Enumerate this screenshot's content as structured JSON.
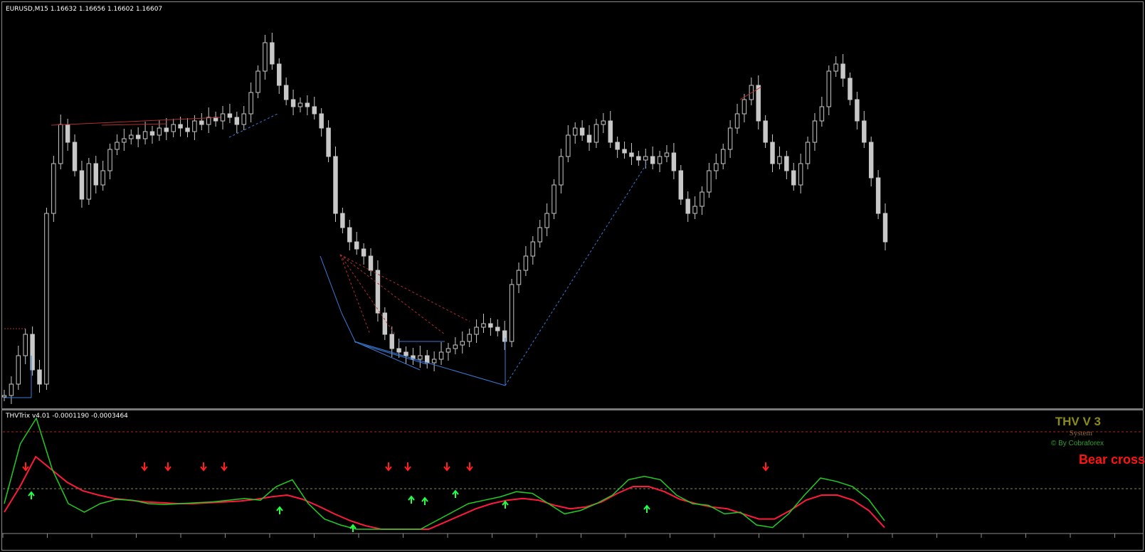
{
  "chart_header": {
    "symbol_line": "EURUSD,M15  1.16632 1.16656 1.16602 1.16607"
  },
  "indicator_header": {
    "label": "THVTrix v4.01 -0.0001190 -0.0003464"
  },
  "thv_box": {
    "title": "THV V 3",
    "system": "System",
    "by": "© By Cobraforex",
    "signal": "Bear cross",
    "signal_color": "#ff1414"
  },
  "colors": {
    "background": "#000000",
    "candles": "#c8c8c8",
    "trix_fast": "#22cc22",
    "trix_slow": "#ff1a3c",
    "arrow_up": "#22ff44",
    "arrow_down": "#ff2020",
    "trendline_blue": "#3a7bd5",
    "trendline_red": "#b03030",
    "level_line": "#b02020"
  },
  "chart_data": {
    "type": "line",
    "title": "",
    "price_path_relative": [
      560,
      540,
      500,
      470,
      520,
      540,
      300,
      230,
      175,
      200,
      240,
      280,
      230,
      260,
      240,
      210,
      200,
      195,
      190,
      195,
      185,
      190,
      180,
      185,
      175,
      180,
      185,
      170,
      175,
      165,
      170,
      160,
      165,
      175,
      160,
      130,
      100,
      60,
      90,
      120,
      140,
      150,
      145,
      150,
      160,
      180,
      220,
      300,
      320,
      340,
      350,
      360,
      380,
      440,
      470,
      490,
      495,
      500,
      505,
      500,
      510,
      505,
      495,
      490,
      485,
      480,
      470,
      460,
      455,
      460,
      465,
      480,
      400,
      380,
      360,
      340,
      320,
      300,
      260,
      220,
      190,
      180,
      190,
      200,
      175,
      170,
      200,
      210,
      215,
      220,
      225,
      220,
      230,
      220,
      215,
      240,
      280,
      300,
      290,
      270,
      240,
      230,
      210,
      180,
      160,
      140,
      120,
      170,
      200,
      230,
      220,
      240,
      260,
      230,
      200,
      170,
      150,
      100,
      90,
      110,
      140,
      170,
      200,
      250,
      300,
      340
    ],
    "trix_fast_relative": [
      100,
      30,
      0,
      60,
      100,
      110,
      100,
      95,
      96,
      100,
      101,
      100,
      99,
      98,
      96,
      94,
      96,
      80,
      72,
      100,
      118,
      125,
      130,
      135,
      140,
      150,
      143,
      120,
      110,
      100,
      96,
      92,
      86,
      88,
      100,
      112,
      108,
      100,
      90,
      72,
      68,
      72,
      90,
      100,
      102,
      112,
      110,
      125,
      128,
      112,
      90,
      70,
      74,
      80,
      95,
      120
    ],
    "trix_slow_relative": [
      110,
      80,
      45,
      60,
      75,
      85,
      90,
      94,
      96,
      98,
      99,
      100,
      100,
      99,
      98,
      97,
      95,
      92,
      90,
      95,
      103,
      112,
      120,
      126,
      132,
      138,
      140,
      134,
      122,
      114,
      106,
      100,
      96,
      94,
      96,
      102,
      106,
      104,
      98,
      88,
      80,
      80,
      86,
      95,
      100,
      104,
      106,
      112,
      118,
      118,
      108,
      96,
      90,
      90,
      96,
      108,
      128
    ]
  }
}
